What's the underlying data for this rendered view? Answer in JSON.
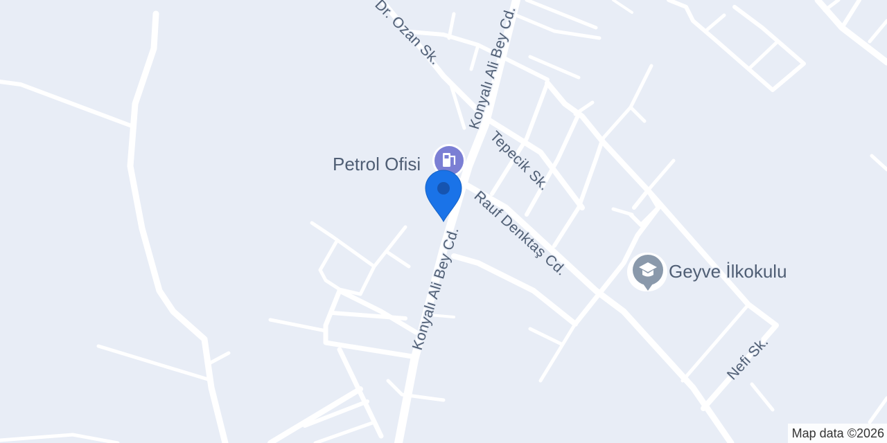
{
  "streets": {
    "dr_ozan": "Dr. Ozan Sk.",
    "konyali_upper": "Konyalı Ali Bey Cd.",
    "konyali_lower": "Konyalı Ali Bey Cd.",
    "tepecik": "Tepecik Sk.",
    "rauf_denktas": "Rauf Denktaş Cd.",
    "nefi": "Nefi Sk."
  },
  "pois": {
    "gas_station": {
      "label": "Petrol Ofisi",
      "icon": "gas-station-icon",
      "color": "#7b7fd4"
    },
    "school": {
      "label": "Geyve İlkokulu",
      "icon": "school-icon",
      "color": "#8a99ab"
    }
  },
  "marker": {
    "icon": "location-pin-icon",
    "color": "#1a73e8"
  },
  "attribution": "Map data ©2026",
  "colors": {
    "background": "#e8edf6",
    "road": "#ffffff",
    "label": "#4f5e74"
  }
}
